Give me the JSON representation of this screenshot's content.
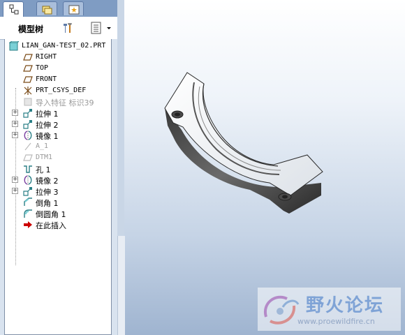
{
  "panel": {
    "title": "模型树",
    "tabs": [
      {
        "icon": "model-tree-icon",
        "active": true
      },
      {
        "icon": "folder-browser-icon",
        "active": false
      },
      {
        "icon": "favorites-icon",
        "active": false
      }
    ]
  },
  "tree": {
    "root": "LIAN_GAN-TEST_02.PRT",
    "items": [
      {
        "label": "RIGHT",
        "icon": "datum-plane-icon",
        "expandable": false,
        "grey": false
      },
      {
        "label": "TOP",
        "icon": "datum-plane-icon",
        "expandable": false,
        "grey": false
      },
      {
        "label": "FRONT",
        "icon": "datum-plane-icon",
        "expandable": false,
        "grey": false
      },
      {
        "label": "PRT_CSYS_DEF",
        "icon": "coordinate-system-icon",
        "expandable": false,
        "grey": false
      },
      {
        "label": "导入特征 标识39",
        "icon": "import-feature-icon",
        "expandable": false,
        "grey": true
      },
      {
        "label": "拉伸 1",
        "icon": "extrude-icon",
        "expandable": true,
        "grey": false
      },
      {
        "label": "拉伸 2",
        "icon": "extrude-icon",
        "expandable": true,
        "grey": false
      },
      {
        "label": "镜像 1",
        "icon": "mirror-icon",
        "expandable": true,
        "grey": false
      },
      {
        "label": "A_1",
        "icon": "datum-axis-icon",
        "expandable": false,
        "grey": true
      },
      {
        "label": "DTM1",
        "icon": "datum-plane-icon",
        "expandable": false,
        "grey": true
      },
      {
        "label": "孔 1",
        "icon": "hole-icon",
        "expandable": false,
        "grey": false
      },
      {
        "label": "镜像 2",
        "icon": "mirror-icon",
        "expandable": true,
        "grey": false
      },
      {
        "label": "拉伸 3",
        "icon": "extrude-icon",
        "expandable": true,
        "grey": false
      },
      {
        "label": "倒角 1",
        "icon": "chamfer-icon",
        "expandable": false,
        "grey": false
      },
      {
        "label": "倒圆角 1",
        "icon": "round-icon",
        "expandable": false,
        "grey": false
      },
      {
        "label": "在此插入",
        "icon": "insert-here-arrow-icon",
        "expandable": false,
        "grey": false
      }
    ]
  },
  "watermark": {
    "title": "野火论坛",
    "url": "www.proewildfire.cn"
  },
  "colors": {
    "tab_bar": "#7f9cc3",
    "panel_bg": "#d9e3ef",
    "insert_arrow": "#cc0000",
    "part_body": "#f2f4f6"
  }
}
